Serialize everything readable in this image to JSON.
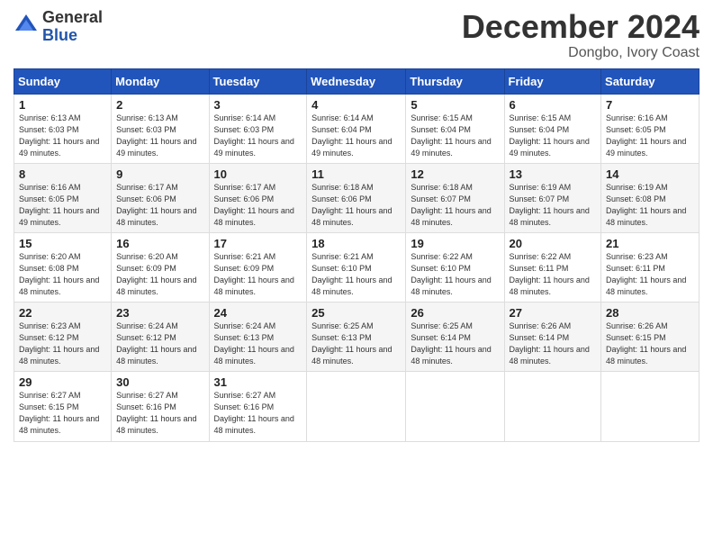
{
  "logo": {
    "general": "General",
    "blue": "Blue"
  },
  "title": {
    "main": "December 2024",
    "sub": "Dongbo, Ivory Coast"
  },
  "calendar": {
    "headers": [
      "Sunday",
      "Monday",
      "Tuesday",
      "Wednesday",
      "Thursday",
      "Friday",
      "Saturday"
    ],
    "rows": [
      [
        {
          "day": "1",
          "info": "Sunrise: 6:13 AM\nSunset: 6:03 PM\nDaylight: 11 hours and 49 minutes."
        },
        {
          "day": "2",
          "info": "Sunrise: 6:13 AM\nSunset: 6:03 PM\nDaylight: 11 hours and 49 minutes."
        },
        {
          "day": "3",
          "info": "Sunrise: 6:14 AM\nSunset: 6:03 PM\nDaylight: 11 hours and 49 minutes."
        },
        {
          "day": "4",
          "info": "Sunrise: 6:14 AM\nSunset: 6:04 PM\nDaylight: 11 hours and 49 minutes."
        },
        {
          "day": "5",
          "info": "Sunrise: 6:15 AM\nSunset: 6:04 PM\nDaylight: 11 hours and 49 minutes."
        },
        {
          "day": "6",
          "info": "Sunrise: 6:15 AM\nSunset: 6:04 PM\nDaylight: 11 hours and 49 minutes."
        },
        {
          "day": "7",
          "info": "Sunrise: 6:16 AM\nSunset: 6:05 PM\nDaylight: 11 hours and 49 minutes."
        }
      ],
      [
        {
          "day": "8",
          "info": "Sunrise: 6:16 AM\nSunset: 6:05 PM\nDaylight: 11 hours and 49 minutes."
        },
        {
          "day": "9",
          "info": "Sunrise: 6:17 AM\nSunset: 6:06 PM\nDaylight: 11 hours and 48 minutes."
        },
        {
          "day": "10",
          "info": "Sunrise: 6:17 AM\nSunset: 6:06 PM\nDaylight: 11 hours and 48 minutes."
        },
        {
          "day": "11",
          "info": "Sunrise: 6:18 AM\nSunset: 6:06 PM\nDaylight: 11 hours and 48 minutes."
        },
        {
          "day": "12",
          "info": "Sunrise: 6:18 AM\nSunset: 6:07 PM\nDaylight: 11 hours and 48 minutes."
        },
        {
          "day": "13",
          "info": "Sunrise: 6:19 AM\nSunset: 6:07 PM\nDaylight: 11 hours and 48 minutes."
        },
        {
          "day": "14",
          "info": "Sunrise: 6:19 AM\nSunset: 6:08 PM\nDaylight: 11 hours and 48 minutes."
        }
      ],
      [
        {
          "day": "15",
          "info": "Sunrise: 6:20 AM\nSunset: 6:08 PM\nDaylight: 11 hours and 48 minutes."
        },
        {
          "day": "16",
          "info": "Sunrise: 6:20 AM\nSunset: 6:09 PM\nDaylight: 11 hours and 48 minutes."
        },
        {
          "day": "17",
          "info": "Sunrise: 6:21 AM\nSunset: 6:09 PM\nDaylight: 11 hours and 48 minutes."
        },
        {
          "day": "18",
          "info": "Sunrise: 6:21 AM\nSunset: 6:10 PM\nDaylight: 11 hours and 48 minutes."
        },
        {
          "day": "19",
          "info": "Sunrise: 6:22 AM\nSunset: 6:10 PM\nDaylight: 11 hours and 48 minutes."
        },
        {
          "day": "20",
          "info": "Sunrise: 6:22 AM\nSunset: 6:11 PM\nDaylight: 11 hours and 48 minutes."
        },
        {
          "day": "21",
          "info": "Sunrise: 6:23 AM\nSunset: 6:11 PM\nDaylight: 11 hours and 48 minutes."
        }
      ],
      [
        {
          "day": "22",
          "info": "Sunrise: 6:23 AM\nSunset: 6:12 PM\nDaylight: 11 hours and 48 minutes."
        },
        {
          "day": "23",
          "info": "Sunrise: 6:24 AM\nSunset: 6:12 PM\nDaylight: 11 hours and 48 minutes."
        },
        {
          "day": "24",
          "info": "Sunrise: 6:24 AM\nSunset: 6:13 PM\nDaylight: 11 hours and 48 minutes."
        },
        {
          "day": "25",
          "info": "Sunrise: 6:25 AM\nSunset: 6:13 PM\nDaylight: 11 hours and 48 minutes."
        },
        {
          "day": "26",
          "info": "Sunrise: 6:25 AM\nSunset: 6:14 PM\nDaylight: 11 hours and 48 minutes."
        },
        {
          "day": "27",
          "info": "Sunrise: 6:26 AM\nSunset: 6:14 PM\nDaylight: 11 hours and 48 minutes."
        },
        {
          "day": "28",
          "info": "Sunrise: 6:26 AM\nSunset: 6:15 PM\nDaylight: 11 hours and 48 minutes."
        }
      ],
      [
        {
          "day": "29",
          "info": "Sunrise: 6:27 AM\nSunset: 6:15 PM\nDaylight: 11 hours and 48 minutes."
        },
        {
          "day": "30",
          "info": "Sunrise: 6:27 AM\nSunset: 6:16 PM\nDaylight: 11 hours and 48 minutes."
        },
        {
          "day": "31",
          "info": "Sunrise: 6:27 AM\nSunset: 6:16 PM\nDaylight: 11 hours and 48 minutes."
        },
        {
          "day": "",
          "info": ""
        },
        {
          "day": "",
          "info": ""
        },
        {
          "day": "",
          "info": ""
        },
        {
          "day": "",
          "info": ""
        }
      ]
    ]
  }
}
